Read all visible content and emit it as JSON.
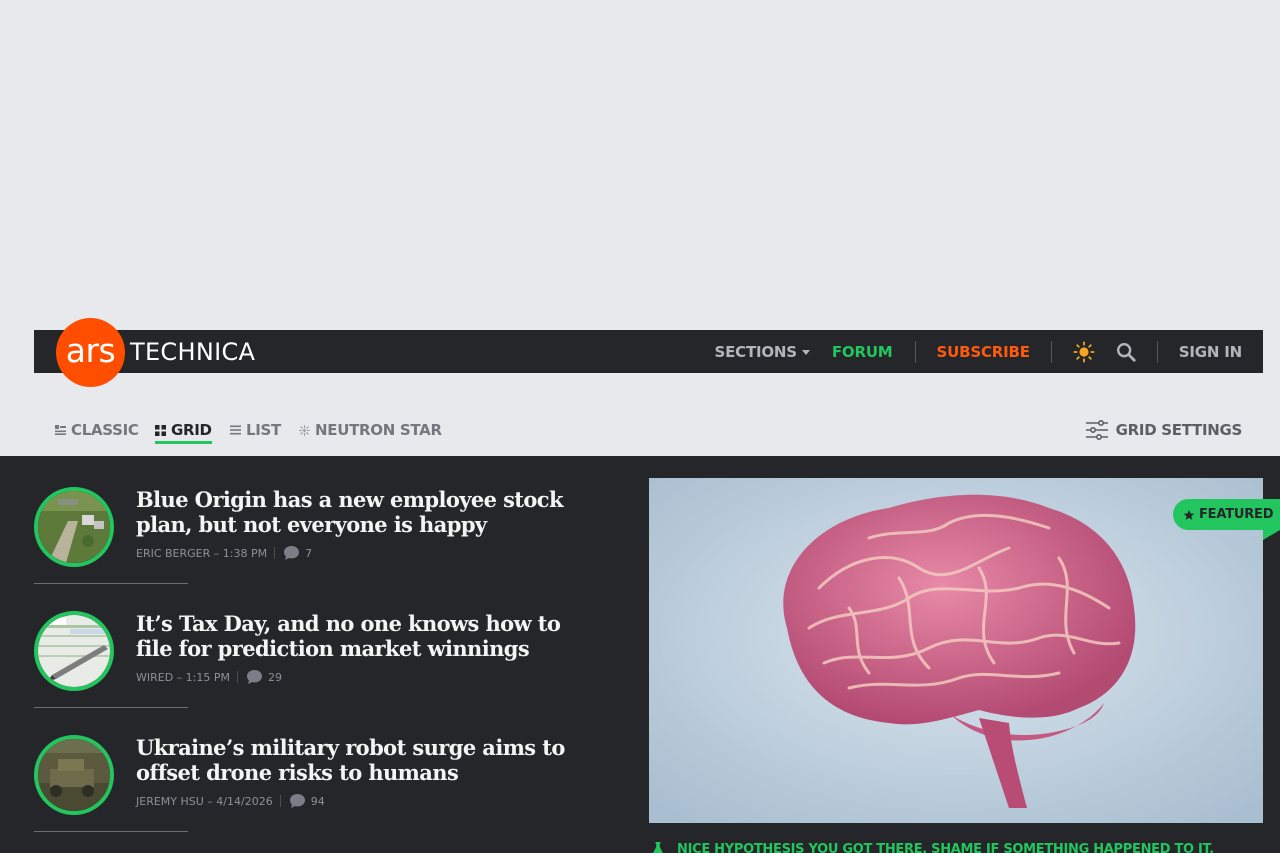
{
  "header": {
    "logo_ars": "ars",
    "logo_technica": "TECHNICA",
    "nav": {
      "sections": "SECTIONS",
      "forum": "FORUM",
      "subscribe": "SUBSCRIBE",
      "signin": "SIGN IN"
    },
    "icons": [
      "sun-icon",
      "search-icon",
      "chevron-down-icon"
    ]
  },
  "toolbar": {
    "views": [
      {
        "label": "CLASSIC",
        "icon": "classic-icon",
        "active": false
      },
      {
        "label": "GRID",
        "icon": "grid-icon",
        "active": true
      },
      {
        "label": "LIST",
        "icon": "list-icon",
        "active": false
      },
      {
        "label": "NEUTRON STAR",
        "icon": "neutron-star-icon",
        "active": false
      }
    ],
    "settings_label": "GRID SETTINGS"
  },
  "stories": [
    {
      "title": "Blue Origin has a new employee stock plan, but not everyone is happy",
      "byline": "ERIC BERGER – 1:38 PM",
      "comments": "7"
    },
    {
      "title": "It’s Tax Day, and no one knows how to file for prediction market winnings",
      "byline": "WIRED – 1:15 PM",
      "comments": "29"
    },
    {
      "title": "Ukraine’s military robot surge aims to offset drone risks to humans",
      "byline": "JEREMY HSU – 4/14/2026",
      "comments": "94"
    }
  ],
  "featured": {
    "badge": "FEATURED",
    "kicker": "NICE HYPOTHESIS YOU GOT THERE. SHAME IF SOMETHING HAPPENED TO IT."
  },
  "colors": {
    "brand_orange": "#ff4e00",
    "accent_green": "#22c55e",
    "subscribe_orange": "#ff5a0d",
    "dark_bg": "#25262a",
    "page_bg": "#e8e9ec"
  }
}
